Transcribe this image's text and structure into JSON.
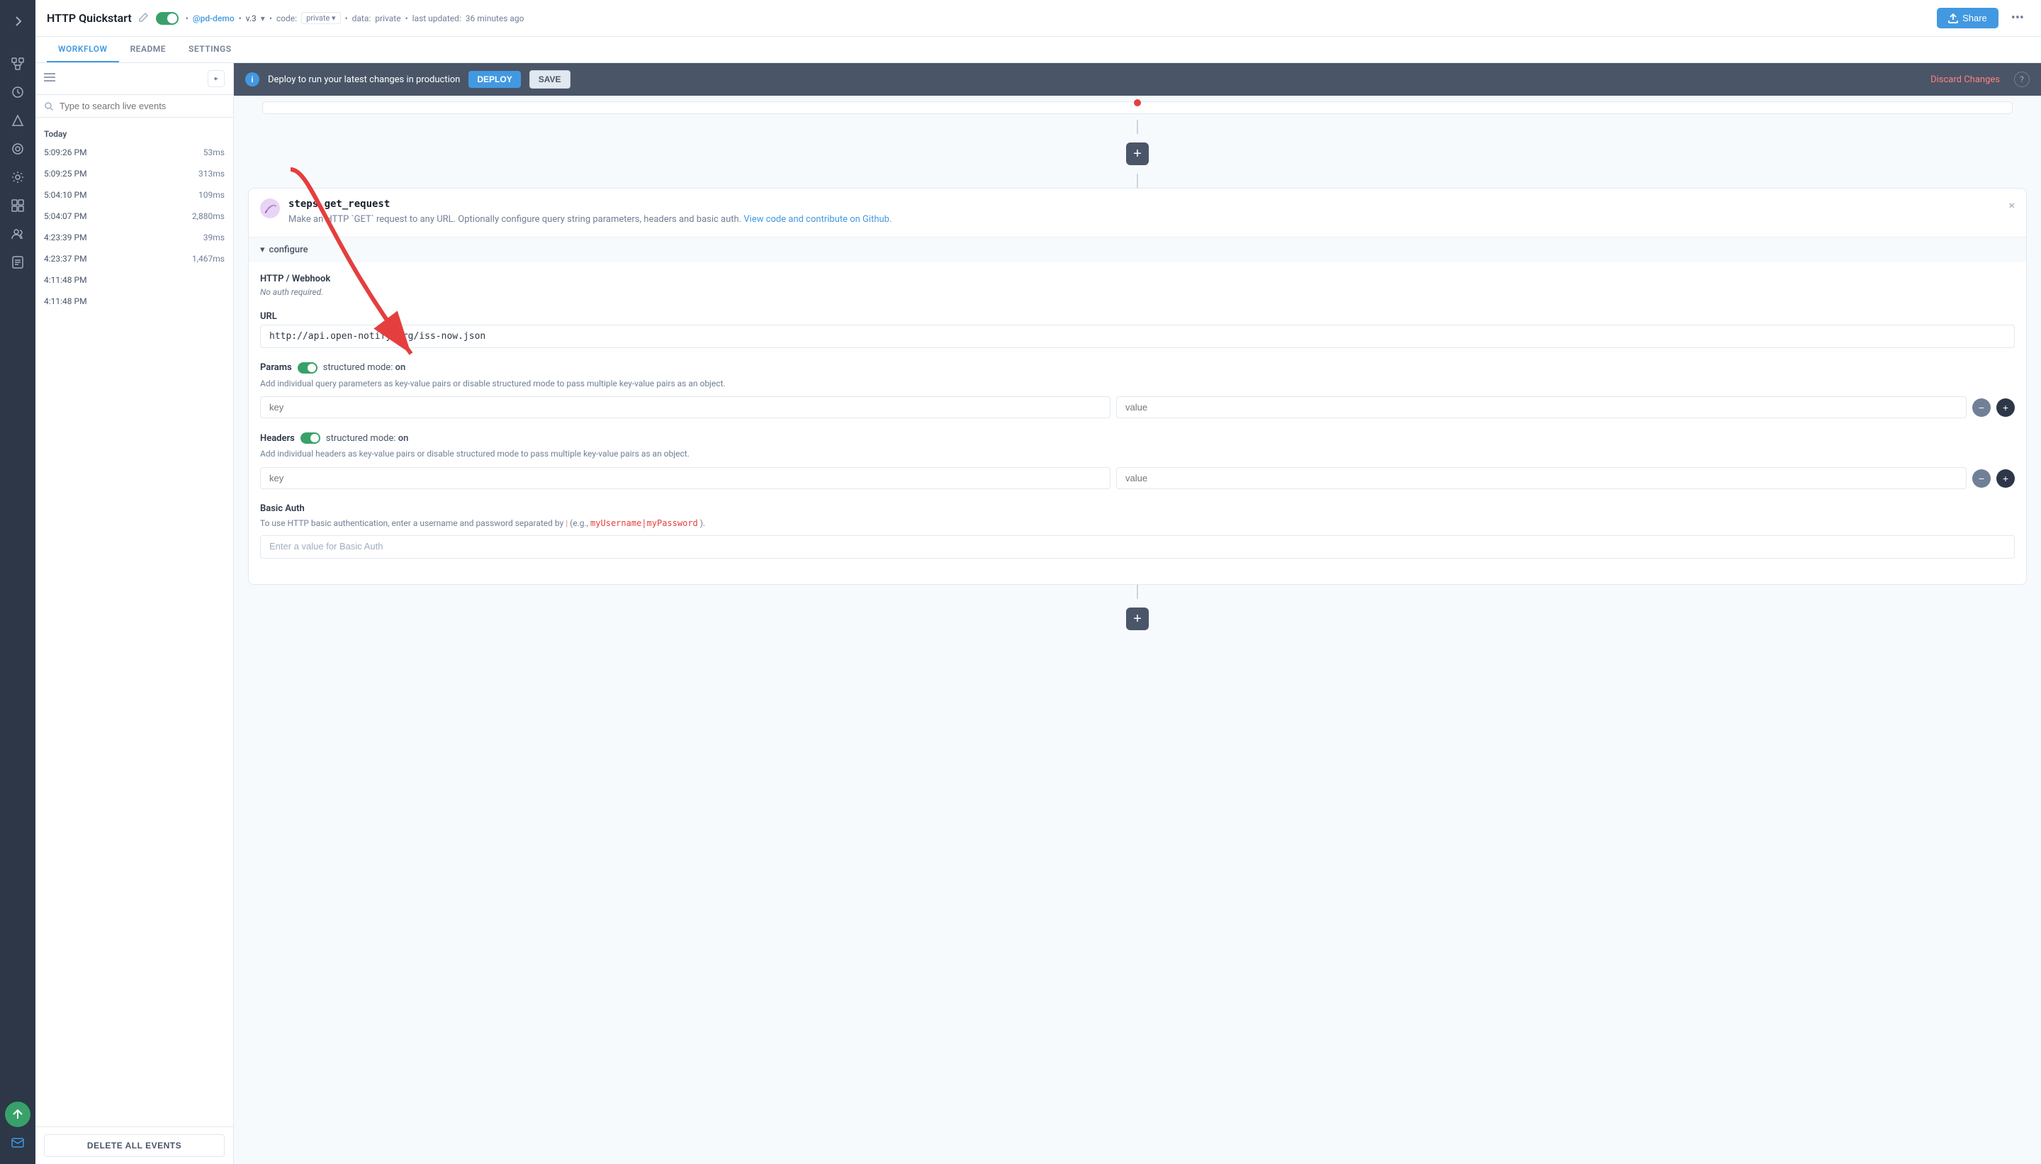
{
  "app": {
    "title": "HTTP Quickstart"
  },
  "header": {
    "title": "HTTP Quickstart",
    "toggle_state": "on",
    "user": "@pd-demo",
    "version": "v.3",
    "code_visibility": "private",
    "data_visibility": "private",
    "last_updated": "36 minutes ago",
    "share_label": "Share",
    "more_icon": "•••"
  },
  "tabs": [
    {
      "id": "workflow",
      "label": "WORKFLOW",
      "active": true
    },
    {
      "id": "readme",
      "label": "README",
      "active": false
    },
    {
      "id": "settings",
      "label": "SETTINGS",
      "active": false
    }
  ],
  "events_panel": {
    "search_placeholder": "Type to search live events",
    "section_label": "Today",
    "events": [
      {
        "time": "5:09:26 PM",
        "duration": "53ms"
      },
      {
        "time": "5:09:25 PM",
        "duration": "313ms"
      },
      {
        "time": "5:04:10 PM",
        "duration": "109ms"
      },
      {
        "time": "5:04:07 PM",
        "duration": "2,880ms"
      },
      {
        "time": "4:23:39 PM",
        "duration": "39ms"
      },
      {
        "time": "4:23:37 PM",
        "duration": "1,467ms"
      },
      {
        "time": "4:11:48 PM",
        "duration": ""
      },
      {
        "time": "4:11:48 PM",
        "duration": ""
      }
    ],
    "delete_all_label": "DELETE ALL EVENTS"
  },
  "deploy_banner": {
    "message": "Deploy to run your latest changes in production",
    "deploy_label": "DEPLOY",
    "save_label": "SAVE",
    "discard_label": "Discard Changes"
  },
  "step": {
    "name": "steps.get_request",
    "description": "Make an HTTP `GET` request to any URL. Optionally configure query string parameters, headers and basic auth.",
    "link_text": "View code and contribute on Github.",
    "configure_label": "configure",
    "sections": {
      "http_webhook": {
        "label": "HTTP / Webhook",
        "sublabel": "No auth required."
      },
      "url": {
        "label": "URL",
        "value": "http://api.open-notify.org/iss-now.json"
      },
      "params": {
        "label": "Params",
        "mode_label": "structured mode:",
        "mode_value": "on",
        "description": "Add individual query parameters as key-value pairs or disable structured mode to pass multiple key-value pairs as an object.",
        "key_placeholder": "key",
        "value_placeholder": "value"
      },
      "headers": {
        "label": "Headers",
        "mode_label": "structured mode:",
        "mode_value": "on",
        "description": "Add individual headers as key-value pairs or disable structured mode to pass multiple key-value pairs as an object.",
        "key_placeholder": "key",
        "value_placeholder": "value"
      },
      "basic_auth": {
        "label": "Basic Auth",
        "description_start": "To use HTTP basic authentication, enter a username and password separated by",
        "description_pipe": "|",
        "description_example": "myUsername|myPassword",
        "description_end": ").",
        "example_prefix": "(e.g., ",
        "placeholder": "Enter a value for Basic Auth"
      }
    }
  },
  "icons": {
    "search": "🔍",
    "menu_lines": "☰",
    "chevron_left": "‹",
    "chevron_right": "›",
    "triangle_down": "▼",
    "plus": "+",
    "close": "×",
    "info": "i",
    "upload": "↑",
    "edit": "✏",
    "more": "•••",
    "expand": "▸",
    "collapse": "▾"
  },
  "colors": {
    "accent_blue": "#4299e1",
    "green": "#38a169",
    "red": "#e53e3e",
    "dark_bg": "#2d3748"
  }
}
